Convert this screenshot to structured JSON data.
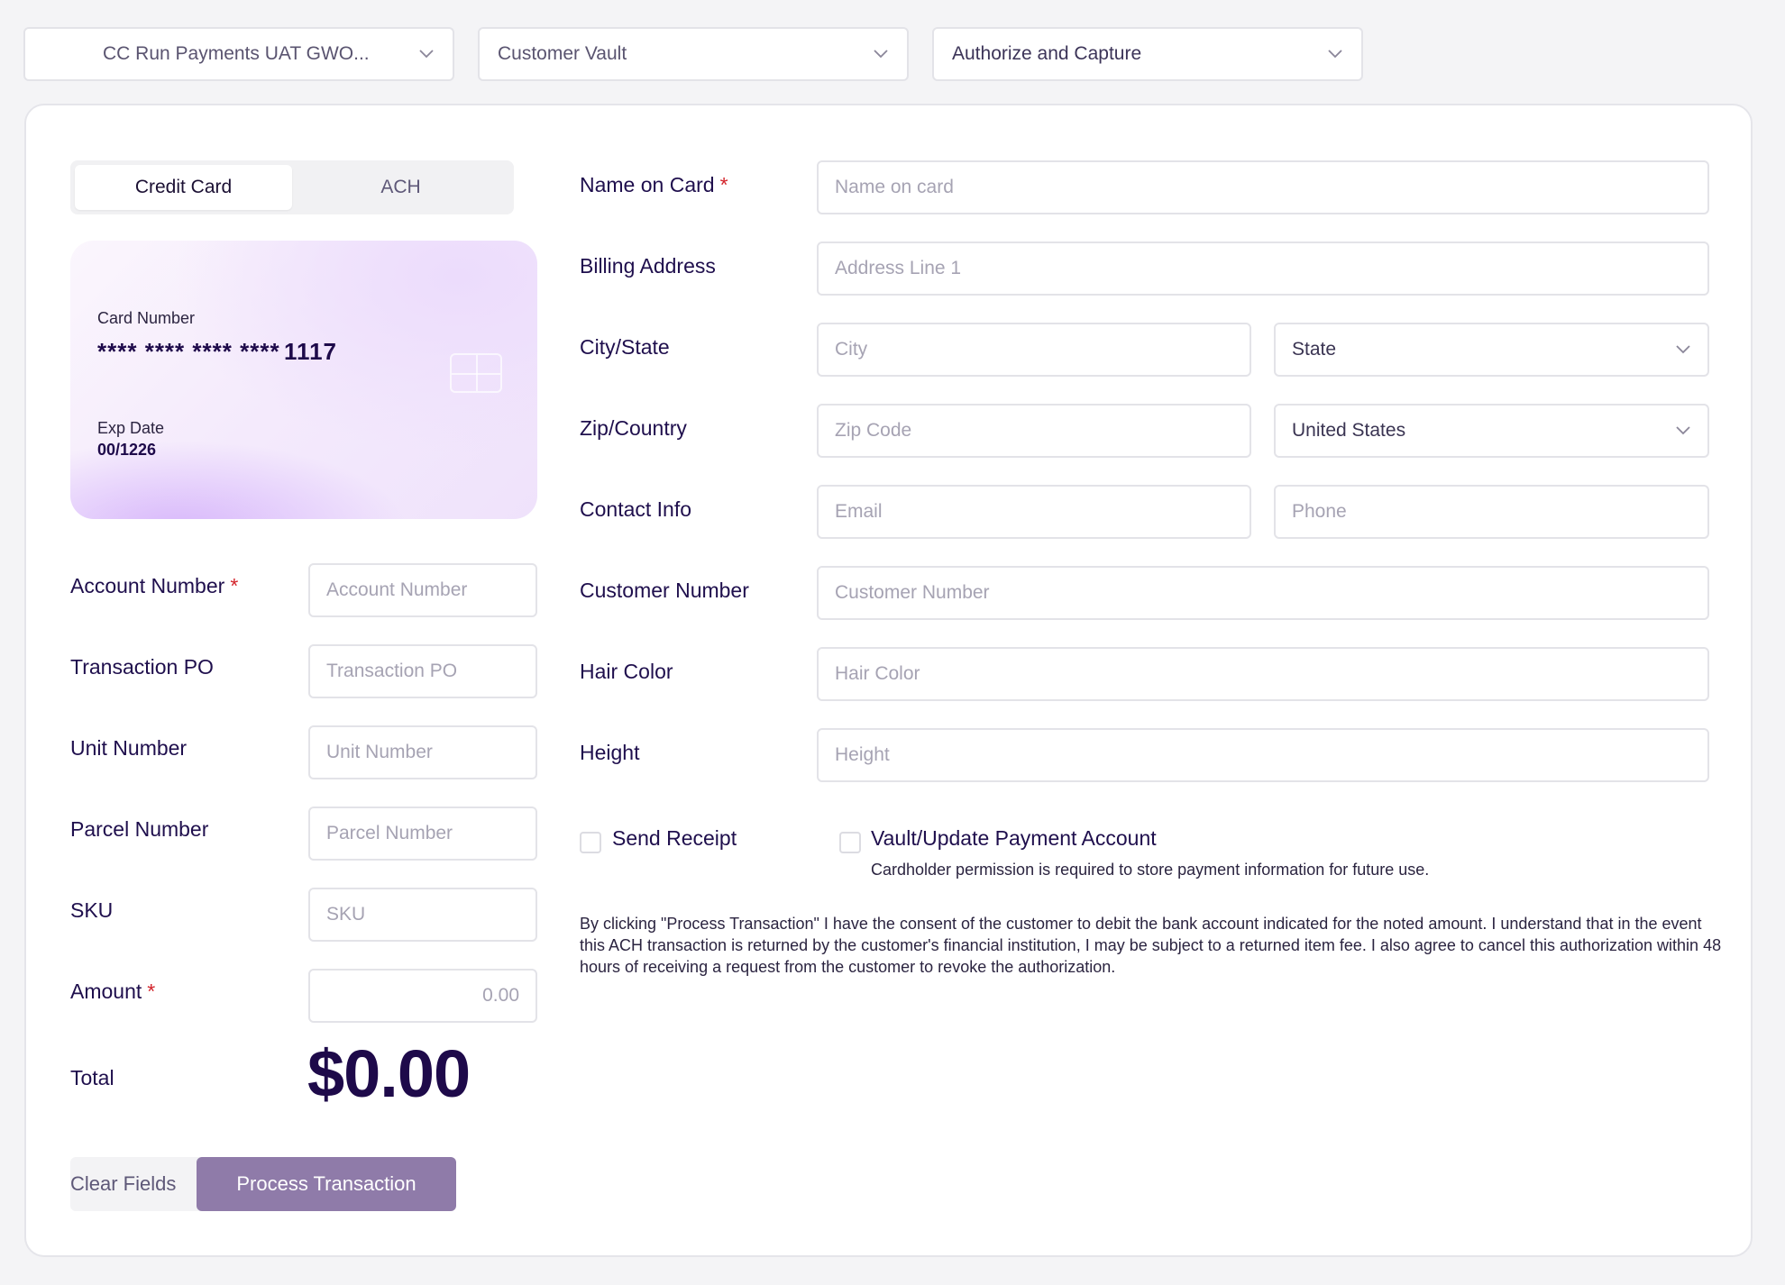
{
  "top_bar": {
    "merchant": "CC Run Payments UAT GWO...",
    "vault": "Customer Vault",
    "transaction_type": "Authorize and Capture"
  },
  "tabs": {
    "credit_card": "Credit Card",
    "ach": "ACH",
    "selected": "Credit Card"
  },
  "card_preview": {
    "number_label": "Card Number",
    "number_mask": "**** **** **** ****",
    "last4": "1117",
    "exp_label": "Exp Date",
    "exp_value": "00/1226"
  },
  "left_form": {
    "account_number": {
      "label": "Account Number",
      "placeholder": "Account Number",
      "required": "*"
    },
    "transaction_po": {
      "label": "Transaction PO",
      "placeholder": "Transaction PO"
    },
    "unit_number": {
      "label": "Unit Number",
      "placeholder": "Unit Number"
    },
    "parcel_number": {
      "label": "Parcel Number",
      "placeholder": "Parcel Number"
    },
    "sku": {
      "label": "SKU",
      "placeholder": "SKU"
    },
    "amount": {
      "label": "Amount",
      "placeholder": "0.00",
      "required": "*"
    },
    "total": {
      "label": "Total",
      "value": "$0.00"
    }
  },
  "right_form": {
    "name_on_card": {
      "label": "Name on Card",
      "placeholder": "Name on card",
      "required": "*"
    },
    "billing_address": {
      "label": "Billing Address",
      "placeholder": "Address Line 1"
    },
    "city_state": {
      "label": "City/State",
      "city_placeholder": "City",
      "state_value": "State"
    },
    "zip_country": {
      "label": "Zip/Country",
      "zip_placeholder": "Zip Code",
      "country_value": "United States"
    },
    "contact_info": {
      "label": "Contact Info",
      "email_placeholder": "Email",
      "phone_placeholder": "Phone"
    },
    "customer_number": {
      "label": "Customer Number",
      "placeholder": "Customer Number"
    },
    "hair_color": {
      "label": "Hair Color",
      "placeholder": "Hair Color"
    },
    "height": {
      "label": "Height",
      "placeholder": "Height"
    }
  },
  "options": {
    "send_receipt": {
      "label": "Send Receipt",
      "checked": false
    },
    "vault_update": {
      "label": "Vault/Update Payment Account",
      "note": "Cardholder permission is required to store payment information for future use.",
      "checked": false
    }
  },
  "consent_text": "By clicking \"Process Transaction\" I have the consent of the customer to debit the bank account indicated for the noted amount. I understand that in the event this ACH transaction is returned by the customer's financial institution, I may be subject to a returned item fee. I also agree to cancel this authorization within 48 hours of receiving a request from the customer to revoke the authorization.",
  "actions": {
    "clear": "Clear Fields",
    "process": "Process Transaction"
  },
  "colors": {
    "primary_text": "#1f0f4d",
    "accent_button": "#8f7ba9",
    "required": "#d3242b"
  }
}
